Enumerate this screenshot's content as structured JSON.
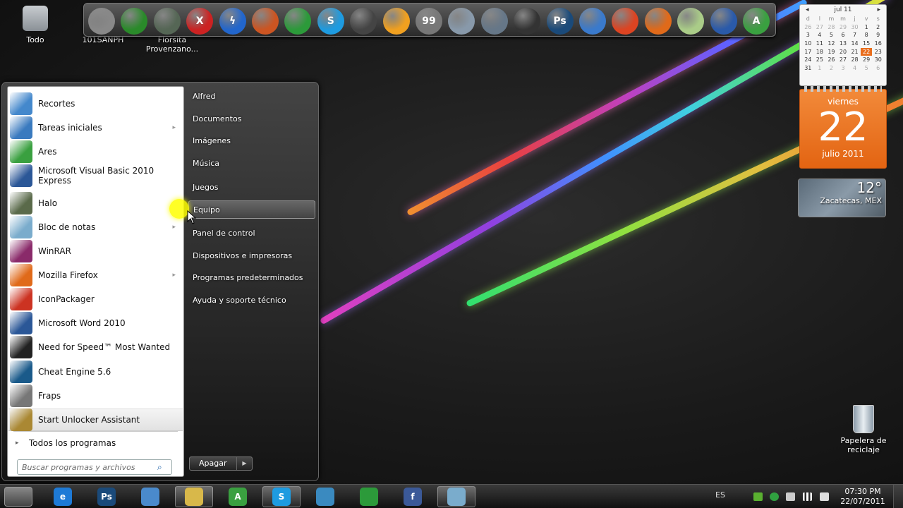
{
  "desktop": {
    "icons": [
      {
        "label": "Todo",
        "icon": "folder-icon"
      },
      {
        "label": "101SANPH",
        "icon": "folder-icon"
      },
      {
        "label": "Florsita Provenzano...",
        "icon": "game-icon"
      }
    ],
    "recycle_bin": {
      "label": "Papelera de reciclaje",
      "icon": "recycle-bin-icon"
    }
  },
  "dock": {
    "items": [
      {
        "name": "folder",
        "color": "#888888",
        "glyph": ""
      },
      {
        "name": "jamaica-ball",
        "color": "#2a8a2a",
        "glyph": ""
      },
      {
        "name": "tank-game",
        "color": "#556655",
        "glyph": ""
      },
      {
        "name": "media-x",
        "color": "#cc2222",
        "glyph": "X"
      },
      {
        "name": "flash-download",
        "color": "#2266cc",
        "glyph": "ϟ"
      },
      {
        "name": "broom",
        "color": "#cc5522",
        "glyph": ""
      },
      {
        "name": "chrome",
        "color": "#2c9a3a",
        "glyph": ""
      },
      {
        "name": "skype",
        "color": "#1e9be0",
        "glyph": "S"
      },
      {
        "name": "camcorder",
        "color": "#444444",
        "glyph": ""
      },
      {
        "name": "messenger-orange",
        "color": "#f0a020",
        "glyph": ""
      },
      {
        "name": "fraps",
        "color": "#777777",
        "glyph": "99"
      },
      {
        "name": "letter",
        "color": "#8899aa",
        "glyph": ""
      },
      {
        "name": "laptop",
        "color": "#667788",
        "glyph": ""
      },
      {
        "name": "clapper",
        "color": "#333333",
        "glyph": ""
      },
      {
        "name": "photoshop",
        "color": "#1a4a7a",
        "glyph": "Ps"
      },
      {
        "name": "chat",
        "color": "#3a7acc",
        "glyph": ""
      },
      {
        "name": "fire-gift",
        "color": "#dd4422",
        "glyph": ""
      },
      {
        "name": "firefox",
        "color": "#e06a1a",
        "glyph": ""
      },
      {
        "name": "flower",
        "color": "#aacc88",
        "glyph": ""
      },
      {
        "name": "google-earth",
        "color": "#2a5aaa",
        "glyph": ""
      },
      {
        "name": "ares",
        "color": "#3aa040",
        "glyph": "A"
      }
    ]
  },
  "calendar": {
    "month_label": "jul 11",
    "weekday_headers": [
      "d",
      "l",
      "m",
      "m",
      "j",
      "v",
      "s"
    ],
    "days": [
      [
        "26",
        "27",
        "28",
        "29",
        "30",
        "1",
        "2"
      ],
      [
        "3",
        "4",
        "5",
        "6",
        "7",
        "8",
        "9"
      ],
      [
        "10",
        "11",
        "12",
        "13",
        "14",
        "15",
        "16"
      ],
      [
        "17",
        "18",
        "19",
        "20",
        "21",
        "22",
        "23"
      ],
      [
        "24",
        "25",
        "26",
        "27",
        "28",
        "29",
        "30"
      ],
      [
        "31",
        "1",
        "2",
        "3",
        "4",
        "5",
        "6"
      ]
    ],
    "today": "22",
    "accent_color": "#e96e1e"
  },
  "big_calendar": {
    "weekday": "viernes",
    "day": "22",
    "month_year": "julio 2011"
  },
  "weather": {
    "temperature": "12°",
    "city": "Zacatecas, MEX"
  },
  "start_menu": {
    "programs": [
      {
        "label": "Recortes",
        "icon": "scissors-icon",
        "color": "#4488cc",
        "has_arrow": false
      },
      {
        "label": "Tareas iniciales",
        "icon": "getting-started-icon",
        "color": "#3a7abf",
        "has_arrow": true
      },
      {
        "label": "Ares",
        "icon": "ares-icon",
        "color": "#3aa040",
        "has_arrow": false
      },
      {
        "label": "Microsoft Visual Basic 2010 Express",
        "icon": "visual-basic-icon",
        "color": "#2b5797",
        "has_arrow": false
      },
      {
        "label": "Halo",
        "icon": "halo-icon",
        "color": "#5a6a4a",
        "has_arrow": false
      },
      {
        "label": "Bloc de notas",
        "icon": "notepad-icon",
        "color": "#7aaccc",
        "has_arrow": true
      },
      {
        "label": "WinRAR",
        "icon": "winrar-icon",
        "color": "#8a2a6a",
        "has_arrow": false
      },
      {
        "label": "Mozilla Firefox",
        "icon": "firefox-icon",
        "color": "#e06a1a",
        "has_arrow": true
      },
      {
        "label": "IconPackager",
        "icon": "iconpackager-icon",
        "color": "#cc3322",
        "has_arrow": false
      },
      {
        "label": "Microsoft Word 2010",
        "icon": "word-icon",
        "color": "#2b5797",
        "has_arrow": false
      },
      {
        "label": "Need for Speed™ Most Wanted",
        "icon": "nfs-icon",
        "color": "#222222",
        "has_arrow": false
      },
      {
        "label": "Cheat Engine 5.6",
        "icon": "cheat-engine-icon",
        "color": "#1a5a8a",
        "has_arrow": false
      },
      {
        "label": "Fraps",
        "icon": "fraps-icon",
        "color": "#777777",
        "has_arrow": false
      },
      {
        "label": "Start Unlocker Assistant",
        "icon": "wand-icon",
        "color": "#aa8833",
        "has_arrow": false
      }
    ],
    "all_programs": "Todos los programas",
    "search_placeholder": "Buscar programas y archivos",
    "right_links": [
      "Alfred",
      "Documentos",
      "Imágenes",
      "Música",
      "Juegos",
      "Equipo",
      "Panel de control",
      "Dispositivos e impresoras",
      "Programas predeterminados",
      "Ayuda y soporte técnico"
    ],
    "highlighted_link": "Equipo",
    "shutdown_label": "Apagar"
  },
  "taskbar": {
    "items": [
      {
        "name": "internet-explorer",
        "color": "#1e7ad6",
        "glyph": "e",
        "active": false
      },
      {
        "name": "photoshop",
        "color": "#1a4a7a",
        "glyph": "Ps",
        "active": false
      },
      {
        "name": "control-panel",
        "color": "#4a8acc",
        "glyph": "",
        "active": false
      },
      {
        "name": "explorer",
        "color": "#d8b84a",
        "glyph": "",
        "active": true
      },
      {
        "name": "ares",
        "color": "#3aa040",
        "glyph": "A",
        "active": false
      },
      {
        "name": "skype",
        "color": "#1e9be0",
        "glyph": "S",
        "active": true
      },
      {
        "name": "messenger",
        "color": "#3a8ac0",
        "glyph": "",
        "active": false
      },
      {
        "name": "chrome",
        "color": "#2c9a3a",
        "glyph": "",
        "active": false
      },
      {
        "name": "facebook",
        "color": "#3b5998",
        "glyph": "f",
        "active": false
      },
      {
        "name": "notepad",
        "color": "#7aaccc",
        "glyph": "",
        "active": true
      }
    ],
    "language": "ES",
    "time": "07:30 PM",
    "date": "22/07/2011"
  }
}
